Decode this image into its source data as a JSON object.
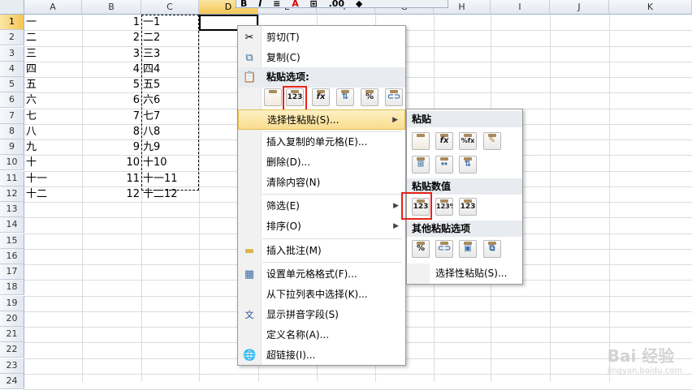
{
  "toolbar": {
    "items": [
      "B",
      "I",
      "≡",
      "A",
      "⊞",
      ".00",
      "◆"
    ]
  },
  "columns": [
    "A",
    "B",
    "C",
    "D",
    "E",
    "F",
    "G",
    "H",
    "I",
    "J",
    "K"
  ],
  "rows": [
    "1",
    "2",
    "3",
    "4",
    "5",
    "6",
    "7",
    "8",
    "9",
    "10",
    "11",
    "12",
    "13",
    "14",
    "15",
    "16",
    "17",
    "18",
    "19",
    "20",
    "21",
    "22",
    "23",
    "24"
  ],
  "cells": {
    "A": [
      "一",
      "二",
      "三",
      "四",
      "五",
      "六",
      "七",
      "八",
      "九",
      "十",
      "十一",
      "十二"
    ],
    "B": [
      "1",
      "2",
      "3",
      "4",
      "5",
      "6",
      "7",
      "8",
      "9",
      "10",
      "11",
      "12"
    ],
    "C": [
      "一1",
      "二2",
      "三3",
      "四4",
      "五5",
      "六6",
      "七7",
      "八8",
      "九9",
      "十10",
      "十一11",
      "十二12"
    ]
  },
  "context_menu": {
    "cut": "剪切(T)",
    "copy": "复制(C)",
    "paste_options_header": "粘贴选项:",
    "paste_option_icons": [
      "paste-icon",
      "paste-values-123-icon",
      "paste-formulas-fx-icon",
      "paste-transpose-icon",
      "paste-formatting-icon",
      "paste-link-icon"
    ],
    "paste_option_labels": [
      "",
      "123",
      "fx",
      "",
      "%",
      ""
    ],
    "paste_special": "选择性粘贴(S)...",
    "insert_copied": "插入复制的单元格(E)...",
    "delete": "删除(D)...",
    "clear": "清除内容(N)",
    "filter": "筛选(E)",
    "sort": "排序(O)",
    "insert_comment": "插入批注(M)",
    "format_cells": "设置单元格格式(F)...",
    "pick_list": "从下拉列表中选择(K)...",
    "phonetic": "显示拼音字段(S)",
    "define_name": "定义名称(A)...",
    "hyperlink": "超链接(I)..."
  },
  "submenu": {
    "paste_header": "粘贴",
    "paste_values_header": "粘贴数值",
    "other_header": "其他粘贴选项",
    "paste_row1_labels": [
      "",
      "fx",
      "%fx",
      ""
    ],
    "values_labels": [
      "123",
      "123%",
      "123"
    ],
    "paste_special": "选择性粘贴(S)..."
  },
  "watermark": {
    "brand": "Bai 经验",
    "url": "jingyan.baidu.com"
  }
}
